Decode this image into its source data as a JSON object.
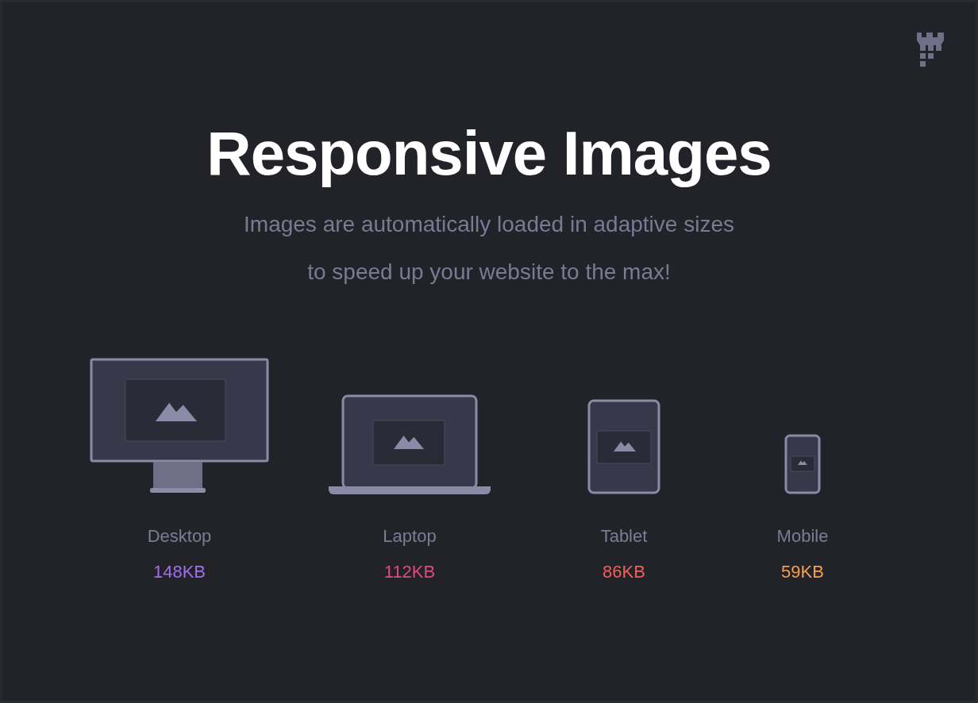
{
  "heading": "Responsive Images",
  "subtitle_lines": [
    "Images are automatically loaded in adaptive sizes",
    "to speed up your website to the max!"
  ],
  "devices": [
    {
      "kind": "desktop",
      "label": "Desktop",
      "size": "148KB",
      "color": "#a06ee8"
    },
    {
      "kind": "laptop",
      "label": "Laptop",
      "size": "112KB",
      "color": "#e04a78"
    },
    {
      "kind": "tablet",
      "label": "Tablet",
      "size": "86KB",
      "color": "#ef6058"
    },
    {
      "kind": "mobile",
      "label": "Mobile",
      "size": "59KB",
      "color": "#f5a050"
    }
  ]
}
